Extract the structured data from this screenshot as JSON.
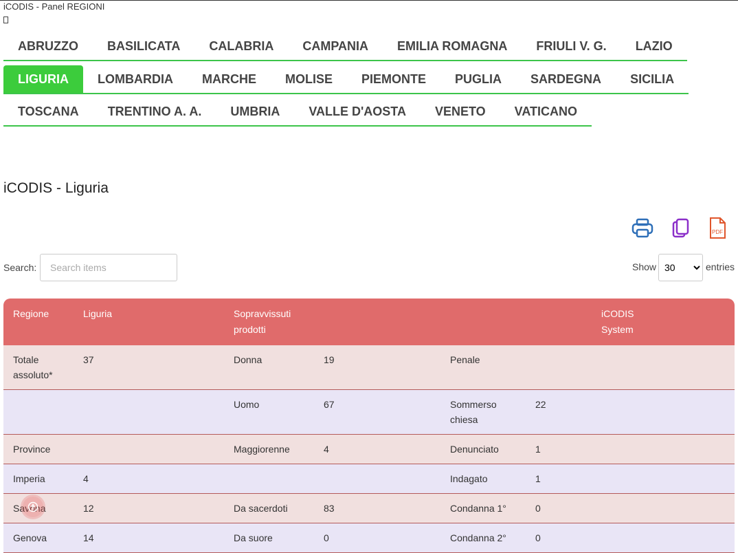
{
  "header": {
    "brand": "iCODIS - Panel REGIONI",
    "regions_rows": [
      [
        "ABRUZZO",
        "BASILICATA",
        "CALABRIA",
        "CAMPANIA",
        "EMILIA ROMAGNA",
        "FRIULI V. G.",
        "LAZIO"
      ],
      [
        "LIGURIA",
        "LOMBARDIA",
        "MARCHE",
        "MOLISE",
        "PIEMONTE",
        "PUGLIA",
        "SARDEGNA",
        "SICILIA"
      ],
      [
        "TOSCANA",
        "TRENTINO A. A.",
        "UMBRIA",
        "VALLE D'AOSTA",
        "VENETO",
        "VATICANO"
      ]
    ],
    "active_region": "LIGURIA"
  },
  "main": {
    "title": "iCODIS - Liguria",
    "toolbar": {
      "print_icon": "printer-icon",
      "copy_icon": "copy-icon",
      "pdf_icon": "pdf-icon",
      "pdf_text": "PDF"
    },
    "search": {
      "label": "Search:",
      "placeholder": "Search items",
      "value": ""
    },
    "entries": {
      "show_label": "Show",
      "selected": "30",
      "suffix": "entries"
    }
  },
  "table": {
    "headers": [
      "Regione",
      "Liguria",
      "Sopravvissuti prodotti",
      "",
      "",
      "",
      "iCODIS System",
      ""
    ],
    "rows": [
      [
        "Totale assoluto*",
        "37",
        "Donna",
        "19",
        "Penale",
        "",
        "",
        ""
      ],
      [
        "",
        "",
        "Uomo",
        "67",
        "Sommerso chiesa",
        "22",
        "",
        ""
      ],
      [
        "Province",
        "",
        "Maggiorenne",
        "4",
        "Denunciato",
        "1",
        "",
        ""
      ],
      [
        "Imperia",
        "4",
        "",
        "",
        "Indagato",
        "1",
        "",
        ""
      ],
      [
        "Savona",
        "12",
        "Da sacerdoti",
        "83",
        "Condanna 1°",
        "0",
        "",
        ""
      ],
      [
        "Genova",
        "14",
        "Da suore",
        "0",
        "Condanna 2°",
        "0",
        "",
        ""
      ]
    ]
  },
  "colors": {
    "accent_green": "#3ccc3c",
    "table_header": "#e06b6b",
    "row_odd": "#f1e0df",
    "row_even": "#e9e5f6"
  }
}
